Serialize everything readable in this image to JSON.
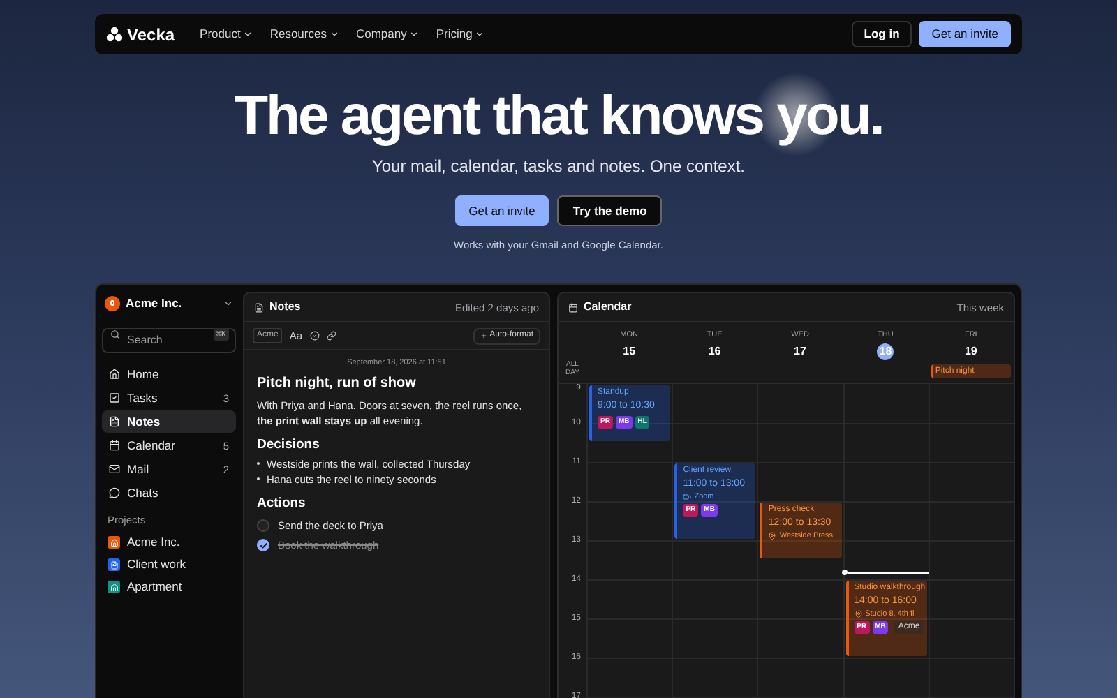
{
  "nav": {
    "logo": "Vecka",
    "menu": [
      {
        "label": "Product"
      },
      {
        "label": "Resources"
      },
      {
        "label": "Company"
      },
      {
        "label": "Pricing"
      }
    ],
    "login": "Log in",
    "cta": "Get an invite"
  },
  "hero": {
    "title": "The agent that knows you.",
    "subtitle": "Your mail, calendar, tasks and notes. One context.",
    "primary": "Get an invite",
    "secondary": "Try the demo",
    "note": "Works with your Gmail and Google Calendar."
  },
  "sidebar": {
    "workspace": "Acme Inc.",
    "search": {
      "placeholder": "Search",
      "shortcut": "⌘K"
    },
    "items": [
      {
        "label": "Home",
        "selected": false
      },
      {
        "label": "Tasks",
        "count": "3",
        "selected": false
      },
      {
        "label": "Notes",
        "selected": true
      },
      {
        "label": "Calendar",
        "count": "5",
        "selected": false
      },
      {
        "label": "Mail",
        "count": "2",
        "selected": false
      },
      {
        "label": "Chats",
        "selected": false
      }
    ],
    "projects_heading": "Projects",
    "projects": [
      {
        "label": "Acme Inc.",
        "color": "#ea580c"
      },
      {
        "label": "Client work",
        "color": "#2563eb"
      },
      {
        "label": "Apartment",
        "color": "#0d9488"
      }
    ]
  },
  "notes": {
    "title": "Notes",
    "edited": "Edited 2 days ago",
    "tag": "Acme",
    "font_button": "Aa",
    "auto_format": "Auto-format",
    "timestamp": "September 18, 2026 at 11:51",
    "blocks": [
      {
        "kind": "title",
        "text": "Pitch night, run of show"
      },
      {
        "kind": "paragraph",
        "text": "With Priya and Hana. Doors at seven, the reel runs once, **the print wall stays up** all evening."
      },
      {
        "kind": "heading",
        "text": "Decisions"
      },
      {
        "kind": "bullet",
        "text": "Westside prints the wall, collected Thursday"
      },
      {
        "kind": "bullet",
        "text": "Hana cuts the reel to ninety seconds"
      },
      {
        "kind": "heading",
        "text": "Actions"
      },
      {
        "kind": "task",
        "text": "Send the deck to Priya",
        "checked": false
      },
      {
        "kind": "task",
        "text": "Book the walkthrough",
        "checked": true
      }
    ]
  },
  "calendar": {
    "title": "Calendar",
    "range": "This week",
    "all_day_label": "ALL DAY",
    "hours": [
      "9",
      "10",
      "11",
      "12",
      "13",
      "14",
      "15",
      "16",
      "17"
    ],
    "days": [
      {
        "weekday": "MON",
        "date": "15",
        "selected": false,
        "events": [
          {
            "title": "Standup",
            "start": "9:00",
            "joiner": "to",
            "end": "10:30",
            "color": "#2563eb",
            "attendees": [
              {
                "initials": "PR",
                "color": "#be185d"
              },
              {
                "initials": "MB",
                "color": "#7c3aed"
              },
              {
                "initials": "HL",
                "color": "#0f766e"
              }
            ]
          }
        ]
      },
      {
        "weekday": "TUE",
        "date": "16",
        "selected": false,
        "events": [
          {
            "title": "Client review",
            "start": "11:00",
            "joiner": "to",
            "end": "13:00",
            "color": "#2563eb",
            "location": "Zoom",
            "kind": "video",
            "attendees": [
              {
                "initials": "PR",
                "color": "#be185d"
              },
              {
                "initials": "MB",
                "color": "#7c3aed"
              }
            ]
          }
        ]
      },
      {
        "weekday": "WED",
        "date": "17",
        "selected": false,
        "events": [
          {
            "title": "Press check",
            "start": "12:00",
            "joiner": "to",
            "end": "13:30",
            "color": "#ea580c",
            "location": "Westside Press",
            "kind": "place"
          }
        ]
      },
      {
        "weekday": "THU",
        "date": "18",
        "selected": true,
        "now": {
          "level": 0.535
        },
        "events": [
          {
            "title": "Studio walkthrough",
            "start": "14:00",
            "joiner": "to",
            "end": "16:00",
            "color": "#ea580c",
            "location": "Studio 8, 4th fl",
            "kind": "place",
            "attendees": [
              {
                "initials": "PR",
                "color": "#be185d"
              },
              {
                "initials": "MB",
                "color": "#7c3aed"
              }
            ],
            "tag": "Acme"
          }
        ]
      },
      {
        "weekday": "FRI",
        "date": "19",
        "selected": false,
        "all_day": [
          {
            "title": "Pitch night",
            "color": "#ea580c"
          }
        ]
      }
    ]
  }
}
